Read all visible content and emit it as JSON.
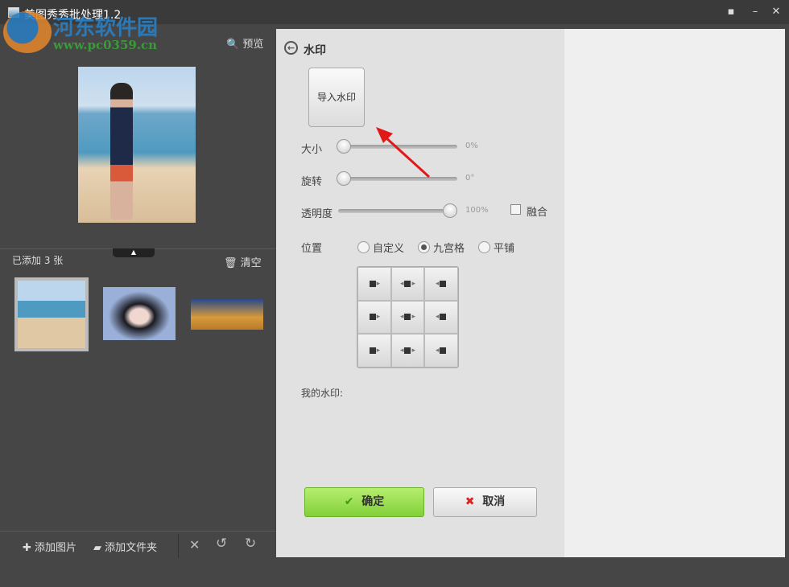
{
  "window": {
    "title": "美图秀秀批处理1.2",
    "watermark_text": "河东软件园",
    "watermark_url": "www.pc0359.cn"
  },
  "left": {
    "preview_label": "预览",
    "added_label": "已添加 3 张",
    "clear_label": "清空",
    "toolbar": {
      "add_image": "添加图片",
      "add_folder": "添加文件夹"
    }
  },
  "panel": {
    "title": "水印",
    "import_label": "导入水印",
    "size": {
      "label": "大小",
      "value": "0%",
      "fraction": 0
    },
    "rotate": {
      "label": "旋转",
      "value": "0°",
      "fraction": 0
    },
    "opacity": {
      "label": "透明度",
      "value": "100%",
      "fraction": 1
    },
    "blend_label": "融合",
    "blend_checked": false,
    "position_label": "位置",
    "position_options": [
      "自定义",
      "九宫格",
      "平铺"
    ],
    "position_selected": "九宫格",
    "my_watermark_label": "我的水印:",
    "ok_label": "确定",
    "cancel_label": "取消"
  }
}
